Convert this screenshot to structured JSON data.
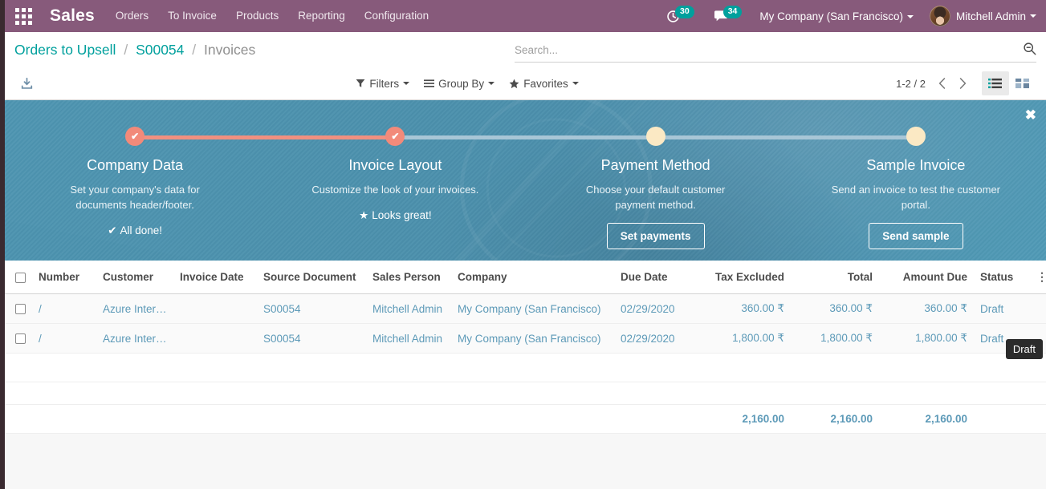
{
  "navbar": {
    "apps_icon": "apps-grid-icon",
    "brand": "Sales",
    "menu": [
      "Orders",
      "To Invoice",
      "Products",
      "Reporting",
      "Configuration"
    ],
    "activity_icon": "clock-icon",
    "activity_count": "30",
    "messaging_icon": "chat-bubble-icon",
    "messaging_count": "34",
    "company": "My Company (San Francisco)",
    "user": "Mitchell Admin",
    "colors": {
      "background": "#875a7b",
      "badge": "#00a09d"
    }
  },
  "control_panel": {
    "breadcrumb": {
      "root": "Orders to Upsell",
      "parent": "S00054",
      "current": "Invoices",
      "separator": "/"
    },
    "search": {
      "placeholder": "Search...",
      "value": "",
      "icon": "search-icon"
    },
    "download_icon": "download-icon",
    "filters": [
      {
        "label": "Filters",
        "icon": "funnel-icon"
      },
      {
        "label": "Group By",
        "icon": "bars-icon"
      },
      {
        "label": "Favorites",
        "icon": "star-icon"
      }
    ],
    "pager": {
      "value": "1-2 / 2",
      "prev_icon": "chevron-left-icon",
      "next_icon": "chevron-right-icon"
    },
    "views": [
      {
        "name": "list",
        "icon": "list-view-icon",
        "active": true
      },
      {
        "name": "kanban",
        "icon": "kanban-view-icon",
        "active": false
      }
    ]
  },
  "banner": {
    "close_icon": "close-icon",
    "colors": {
      "background": "#4b90ac",
      "done": "#f28a7a",
      "todo": "#fbe9c4",
      "line_todo": "#a8c6d6"
    },
    "steps": [
      {
        "title": "Company Data",
        "description": "Set your company's data for documents header/footer.",
        "state": "done",
        "action_type": "text",
        "action_label": "All done!",
        "action_icon": "check-icon"
      },
      {
        "title": "Invoice Layout",
        "description": "Customize the look of your invoices.",
        "state": "done",
        "action_type": "text",
        "action_label": "Looks great!",
        "action_icon": "star-icon"
      },
      {
        "title": "Payment Method",
        "description": "Choose your default customer payment method.",
        "state": "todo",
        "action_type": "button",
        "action_label": "Set payments"
      },
      {
        "title": "Sample Invoice",
        "description": "Send an invoice to test the customer portal.",
        "state": "todo",
        "action_type": "button",
        "action_label": "Send sample"
      }
    ]
  },
  "list": {
    "columns": [
      "Number",
      "Customer",
      "Invoice Date",
      "Source Document",
      "Sales Person",
      "Company",
      "Due Date",
      "Tax Excluded",
      "Total",
      "Amount Due",
      "Status"
    ],
    "options_icon": "vertical-dots-icon",
    "rows": [
      {
        "number": "/",
        "customer": "Azure Interior",
        "invoice_date": "",
        "source_document": "S00054",
        "sales_person": "Mitchell Admin",
        "company": "My Company (San Francisco)",
        "due_date": "02/29/2020",
        "tax_excluded": "360.00 ₹",
        "total": "360.00 ₹",
        "amount_due": "360.00 ₹",
        "status": "Draft"
      },
      {
        "number": "/",
        "customer": "Azure Interior",
        "invoice_date": "",
        "source_document": "S00054",
        "sales_person": "Mitchell Admin",
        "company": "My Company (San Francisco)",
        "due_date": "02/29/2020",
        "tax_excluded": "1,800.00 ₹",
        "total": "1,800.00 ₹",
        "amount_due": "1,800.00 ₹",
        "status": "Draft"
      }
    ],
    "totals": {
      "tax_excluded": "2,160.00",
      "total": "2,160.00",
      "amount_due": "2,160.00"
    }
  },
  "tooltip": {
    "text": "Draft"
  }
}
